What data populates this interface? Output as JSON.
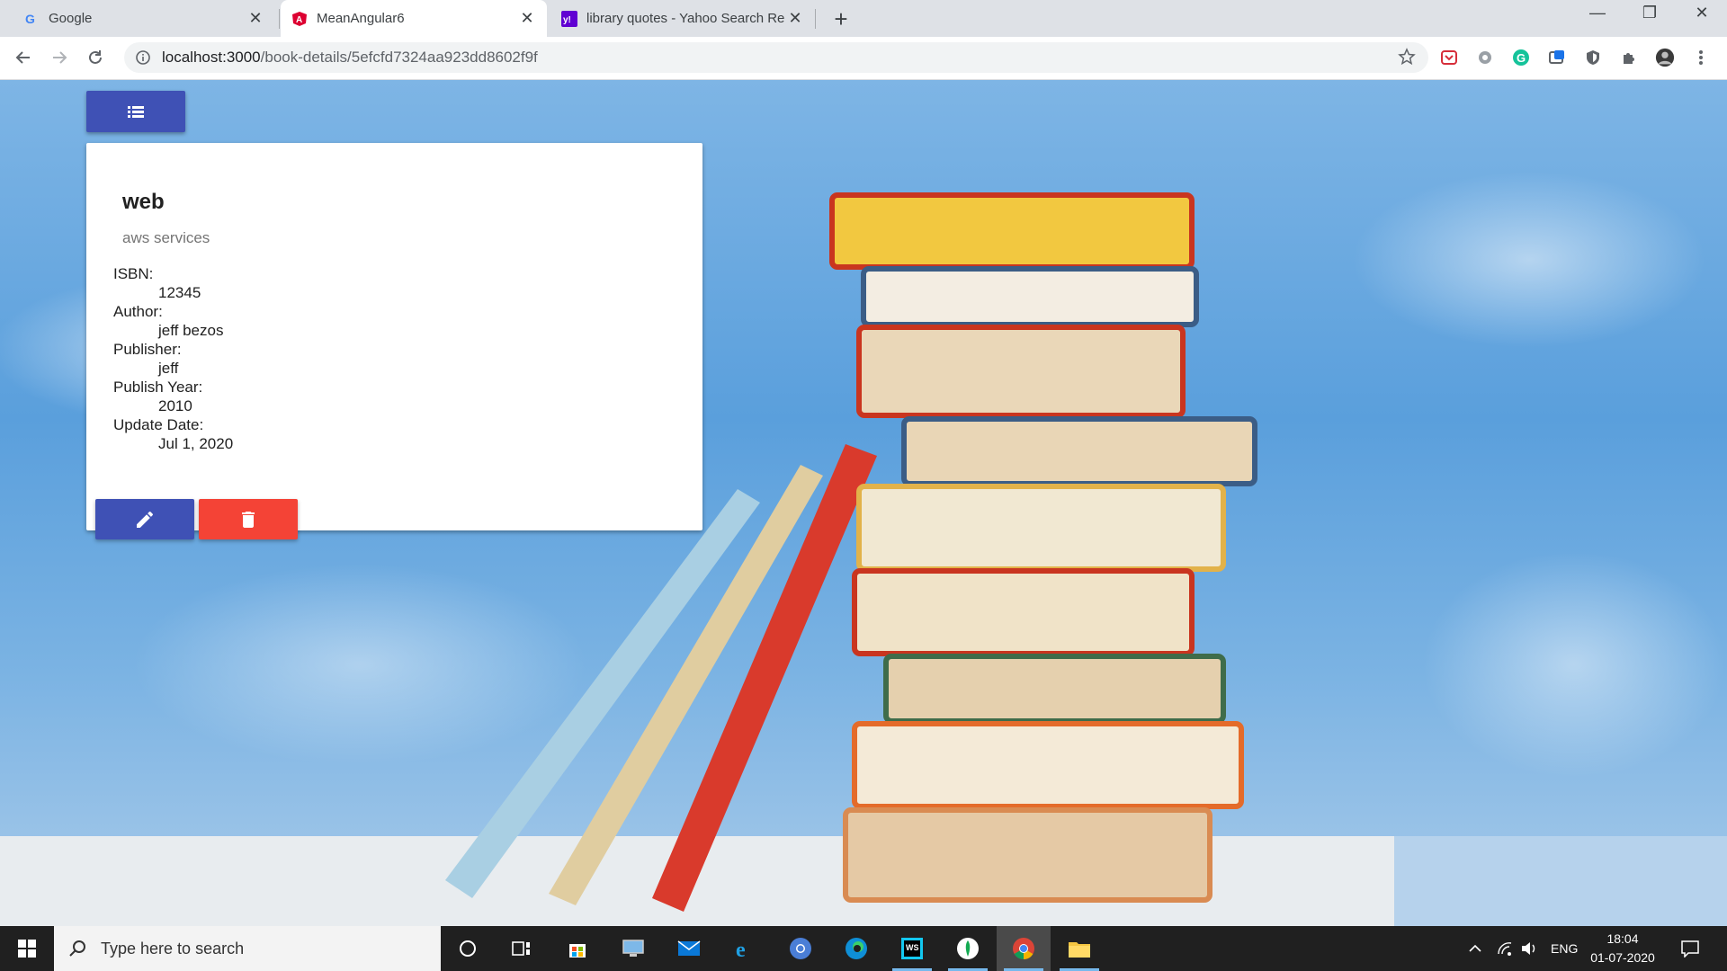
{
  "browser": {
    "tabs": [
      {
        "title": "Google",
        "active": false,
        "favicon": "google-icon"
      },
      {
        "title": "MeanAngular6",
        "active": true,
        "favicon": "angular-icon"
      },
      {
        "title": "library quotes - Yahoo Search Re",
        "active": false,
        "favicon": "yahoo-icon"
      }
    ],
    "url": {
      "host": "localhost:3000",
      "path": "/book-details/5efcfd7324aa923dd8602f9f"
    }
  },
  "book": {
    "title": "web",
    "description": "aws services",
    "fields": [
      {
        "label": "ISBN:",
        "value": "12345"
      },
      {
        "label": "Author:",
        "value": "jeff bezos"
      },
      {
        "label": "Publisher:",
        "value": "jeff"
      },
      {
        "label": "Publish Year:",
        "value": "2010"
      },
      {
        "label": "Update Date:",
        "value": "Jul 1, 2020"
      }
    ]
  },
  "colors": {
    "primary": "#3f51b5",
    "warn": "#f44336"
  },
  "taskbar": {
    "search_placeholder": "Type here to search",
    "language": "ENG",
    "time": "18:04",
    "date": "01-07-2020"
  }
}
